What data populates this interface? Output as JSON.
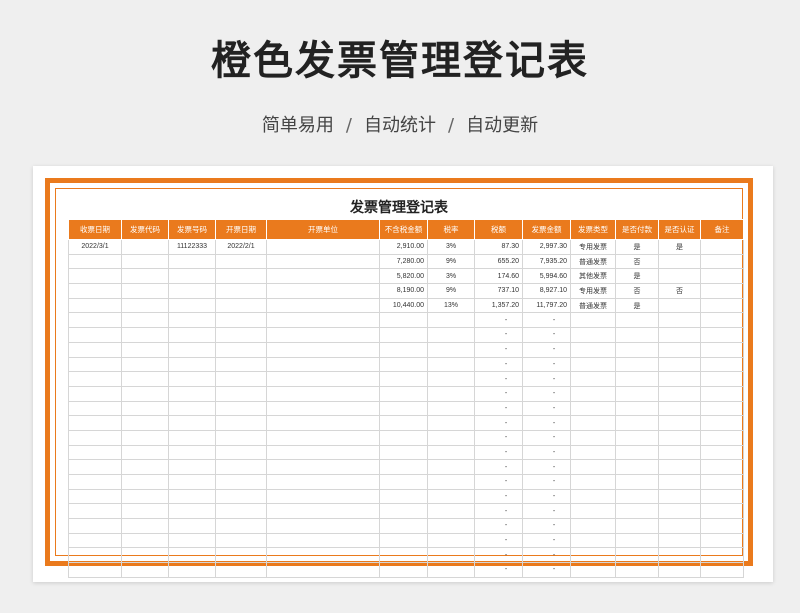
{
  "page": {
    "title": "橙色发票管理登记表",
    "subtitle_parts": [
      "简单易用",
      "自动统计",
      "自动更新"
    ],
    "separator": "/",
    "accent_color": "#ea7a1d"
  },
  "sheet": {
    "title": "发票管理登记表",
    "headers": [
      "收票日期",
      "发票代码",
      "发票号码",
      "开票日期",
      "开票单位",
      "不含税金额",
      "税率",
      "税额",
      "发票金额",
      "发票类型",
      "是否付款",
      "是否认证",
      "备注"
    ],
    "rows": [
      [
        "2022/3/1",
        "",
        "11122333",
        "2022/2/1",
        "",
        "2,910.00",
        "3%",
        "87.30",
        "2,997.30",
        "专用发票",
        "是",
        "是",
        ""
      ],
      [
        "",
        "",
        "",
        "",
        "",
        "7,280.00",
        "9%",
        "655.20",
        "7,935.20",
        "普通发票",
        "否",
        "",
        ""
      ],
      [
        "",
        "",
        "",
        "",
        "",
        "5,820.00",
        "3%",
        "174.60",
        "5,994.60",
        "其他发票",
        "是",
        "",
        ""
      ],
      [
        "",
        "",
        "",
        "",
        "",
        "8,190.00",
        "9%",
        "737.10",
        "8,927.10",
        "专用发票",
        "否",
        "否",
        ""
      ],
      [
        "",
        "",
        "",
        "",
        "",
        "10,440.00",
        "13%",
        "1,357.20",
        "11,797.20",
        "普通发票",
        "是",
        "",
        ""
      ],
      [
        "",
        "",
        "",
        "",
        "",
        "",
        "",
        "-",
        "-",
        "",
        "",
        "",
        ""
      ],
      [
        "",
        "",
        "",
        "",
        "",
        "",
        "",
        "-",
        "-",
        "",
        "",
        "",
        ""
      ],
      [
        "",
        "",
        "",
        "",
        "",
        "",
        "",
        "-",
        "-",
        "",
        "",
        "",
        ""
      ],
      [
        "",
        "",
        "",
        "",
        "",
        "",
        "",
        "-",
        "-",
        "",
        "",
        "",
        ""
      ],
      [
        "",
        "",
        "",
        "",
        "",
        "",
        "",
        "-",
        "-",
        "",
        "",
        "",
        ""
      ],
      [
        "",
        "",
        "",
        "",
        "",
        "",
        "",
        "-",
        "-",
        "",
        "",
        "",
        ""
      ],
      [
        "",
        "",
        "",
        "",
        "",
        "",
        "",
        "-",
        "-",
        "",
        "",
        "",
        ""
      ],
      [
        "",
        "",
        "",
        "",
        "",
        "",
        "",
        "-",
        "-",
        "",
        "",
        "",
        ""
      ],
      [
        "",
        "",
        "",
        "",
        "",
        "",
        "",
        "-",
        "-",
        "",
        "",
        "",
        ""
      ],
      [
        "",
        "",
        "",
        "",
        "",
        "",
        "",
        "-",
        "-",
        "",
        "",
        "",
        ""
      ],
      [
        "",
        "",
        "",
        "",
        "",
        "",
        "",
        "-",
        "-",
        "",
        "",
        "",
        ""
      ],
      [
        "",
        "",
        "",
        "",
        "",
        "",
        "",
        "-",
        "-",
        "",
        "",
        "",
        ""
      ],
      [
        "",
        "",
        "",
        "",
        "",
        "",
        "",
        "-",
        "-",
        "",
        "",
        "",
        ""
      ],
      [
        "",
        "",
        "",
        "",
        "",
        "",
        "",
        "-",
        "-",
        "",
        "",
        "",
        ""
      ],
      [
        "",
        "",
        "",
        "",
        "",
        "",
        "",
        "-",
        "-",
        "",
        "",
        "",
        ""
      ],
      [
        "",
        "",
        "",
        "",
        "",
        "",
        "",
        "-",
        "-",
        "",
        "",
        "",
        ""
      ],
      [
        "",
        "",
        "",
        "",
        "",
        "",
        "",
        "-",
        "-",
        "",
        "",
        "",
        ""
      ],
      [
        "",
        "",
        "",
        "",
        "",
        "",
        "",
        "-",
        "-",
        "",
        "",
        "",
        ""
      ]
    ]
  }
}
